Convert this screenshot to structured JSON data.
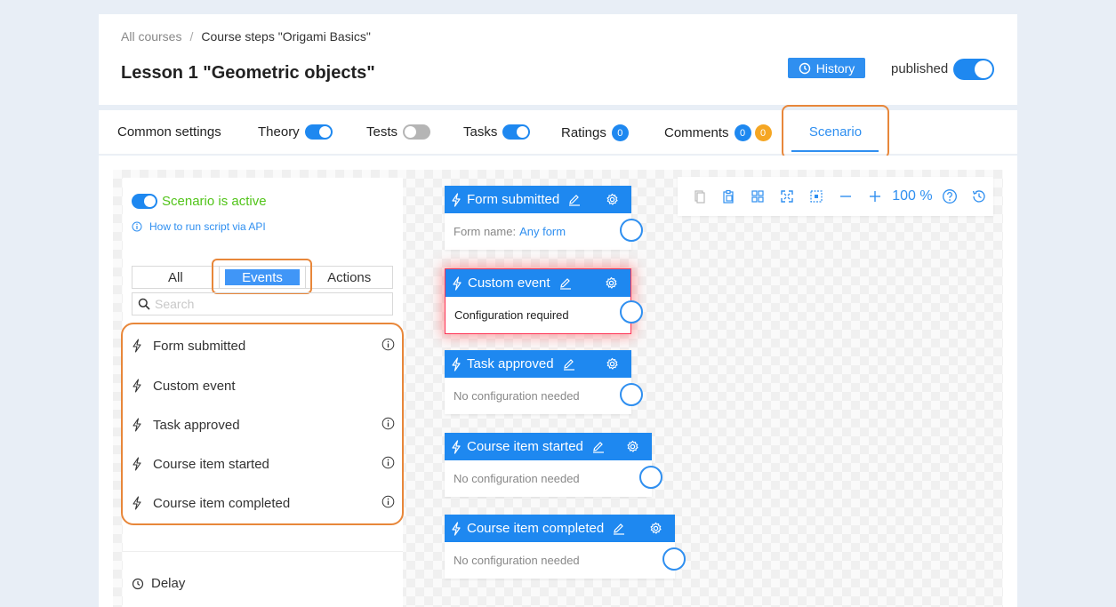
{
  "breadcrumb": {
    "root": "All courses",
    "separator": "/",
    "current": "Course steps \"Origami Basics\""
  },
  "lesson_title": "Lesson 1 \"Geometric objects\"",
  "history_label": "History",
  "published_label": "published",
  "tabs": {
    "common": "Common settings",
    "theory": "Theory",
    "tests": "Tests",
    "tasks": "Tasks",
    "ratings": "Ratings",
    "ratings_count": "0",
    "comments": "Comments",
    "comments_count_a": "0",
    "comments_count_b": "0",
    "scenario": "Scenario"
  },
  "panel": {
    "active_label": "Scenario is active",
    "api_link": "How to run script via API",
    "filter_all": "All",
    "filter_events": "Events",
    "filter_actions": "Actions",
    "search_placeholder": "Search",
    "items": [
      "Form submitted",
      "Custom event",
      "Task approved",
      "Course item started",
      "Course item completed"
    ],
    "delay": "Delay"
  },
  "nodes": [
    {
      "title": "Form submitted",
      "body_label": "Form name:",
      "body_value": "Any form"
    },
    {
      "title": "Custom event",
      "body": "Configuration required"
    },
    {
      "title": "Task approved",
      "body": "No configuration needed"
    },
    {
      "title": "Course item started",
      "body": "No configuration needed"
    },
    {
      "title": "Course item completed",
      "body": "No configuration needed"
    }
  ],
  "toolbar": {
    "zoom": "100 %"
  },
  "colors": {
    "accent": "#1e88f0",
    "highlight": "#e8873a",
    "active_green": "#52c41a",
    "warning_badge": "#f5a623"
  }
}
